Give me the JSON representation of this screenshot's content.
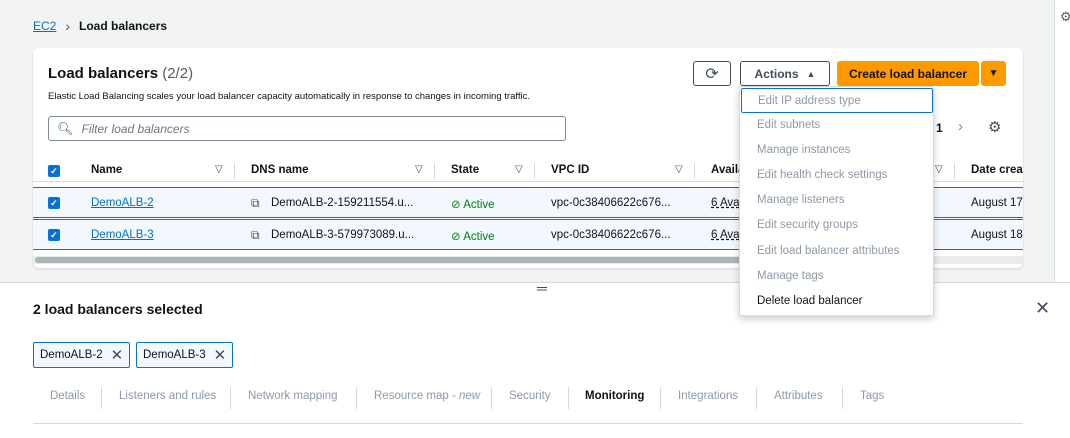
{
  "breadcrumb": {
    "root": "EC2",
    "current": "Load balancers"
  },
  "list": {
    "title": "Load balancers",
    "count": "(2/2)",
    "description": "Elastic Load Balancing scales your load balancer capacity automatically in response to changes in incoming traffic.",
    "actions_label": "Actions",
    "create_label": "Create load balancer",
    "filter_placeholder": "Filter load balancers",
    "page": "1"
  },
  "columns": [
    "Name",
    "DNS name",
    "State",
    "VPC ID",
    "Availability Zones",
    "Date created"
  ],
  "columns_visible": [
    "Name",
    "DNS name",
    "State",
    "VPC ID",
    "Availa",
    "Date creat"
  ],
  "rows": [
    {
      "name": "DemoALB-2",
      "dns": "DemoALB-2-159211554.u...",
      "state": "Active",
      "vpc": "vpc-0c38406622c676...",
      "az": "6 Ava",
      "date": "August 17"
    },
    {
      "name": "DemoALB-3",
      "dns": "DemoALB-3-579973089.u...",
      "state": "Active",
      "vpc": "vpc-0c38406622c676...",
      "az": "6 Ava",
      "date": "August 18"
    }
  ],
  "actions_menu": [
    {
      "label": "Edit IP address type",
      "enabled": false
    },
    {
      "label": "Edit subnets",
      "enabled": false
    },
    {
      "label": "Manage instances",
      "enabled": false
    },
    {
      "label": "Edit health check settings",
      "enabled": false
    },
    {
      "label": "Manage listeners",
      "enabled": false
    },
    {
      "label": "Edit security groups",
      "enabled": false
    },
    {
      "label": "Edit load balancer attributes",
      "enabled": false
    },
    {
      "label": "Manage tags",
      "enabled": false
    },
    {
      "label": "Delete load balancer",
      "enabled": true
    }
  ],
  "details": {
    "title": "2 load balancers selected",
    "tokens": [
      "DemoALB-2",
      "DemoALB-3"
    ],
    "tabs": [
      {
        "label": "Details"
      },
      {
        "label": "Listeners and rules"
      },
      {
        "label": "Network mapping"
      },
      {
        "label": "Resource map",
        "suffix": " - new"
      },
      {
        "label": "Security"
      },
      {
        "label": "Monitoring",
        "active": true
      },
      {
        "label": "Integrations"
      },
      {
        "label": "Attributes"
      },
      {
        "label": "Tags"
      }
    ]
  },
  "colors": {
    "primary": "#ff9900",
    "link": "#0073bb",
    "selection": "#0972d3",
    "success": "#037f0c"
  },
  "icons": [
    "refresh-icon",
    "caret-up-icon",
    "caret-down-icon",
    "search-icon",
    "chevron-right-icon",
    "gear-icon",
    "sort-icon",
    "copy-icon",
    "status-success-icon",
    "close-icon",
    "resize-handle-icon"
  ]
}
